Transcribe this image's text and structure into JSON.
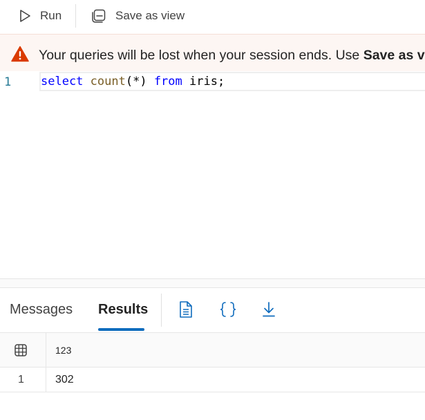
{
  "toolbar": {
    "run_label": "Run",
    "save_view_label": "Save as view"
  },
  "banner": {
    "message_prefix": "Your queries will be lost when your session ends. Use ",
    "message_bold": "Save as view"
  },
  "editor": {
    "line_number": "1",
    "tokens": {
      "t1": "select",
      "t2": " ",
      "t3": "count",
      "t4": "(*) ",
      "t5": "from",
      "t6": " iris;"
    }
  },
  "results": {
    "tabs": {
      "messages": "Messages",
      "results": "Results"
    },
    "column_header": "123",
    "rows": [
      {
        "row_number": "1",
        "value": "302"
      }
    ]
  },
  "colors": {
    "accent": "#0f6cbd",
    "warning": "#da3b01",
    "keyword": "#0000ff",
    "function": "#795e26"
  },
  "icons": {
    "run": "play-icon",
    "save_view": "save-as-view-icon",
    "warning": "warning-icon",
    "text_view": "document-icon",
    "json_view": "braces-icon",
    "download": "download-icon",
    "grid": "table-icon"
  }
}
